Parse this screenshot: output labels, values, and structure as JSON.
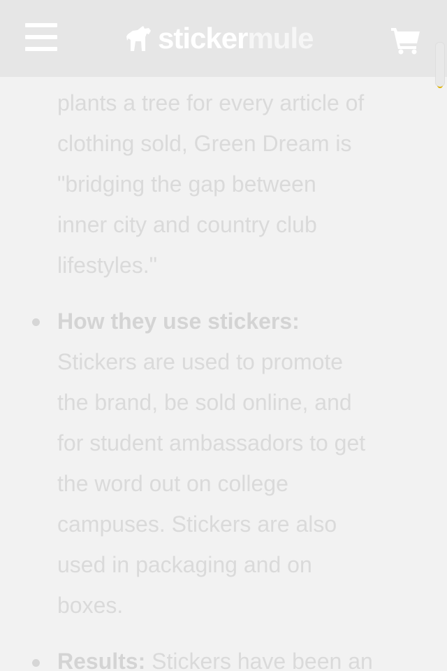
{
  "header": {
    "brand_part1": "sticker",
    "brand_part2": "mule",
    "menu_icon": "hamburger-menu-icon",
    "cart_icon": "shopping-cart-icon",
    "logo_icon": "mule-logo-icon"
  },
  "article": {
    "intro_lines": [
      "plants a tree for every article of",
      "clothing sold, Green Dream is",
      "\"bridging the gap between",
      "inner city and country club",
      "lifestyles.\""
    ],
    "usage": {
      "heading": "How they use stickers:",
      "lines": [
        "Stickers are used to promote",
        "the brand, be sold online, and",
        "for student ambassadors to get",
        "the word out on college",
        "campuses. Stickers are also",
        "used in packaging and on",
        "boxes."
      ]
    },
    "results": {
      "heading": "Results:",
      "text": "Stickers have been an"
    }
  },
  "colors": {
    "header_bg": "#e6e6e6",
    "page_bg": "#f2f2f2",
    "text": "#dadada",
    "scroll_accent": "#e2b400"
  }
}
